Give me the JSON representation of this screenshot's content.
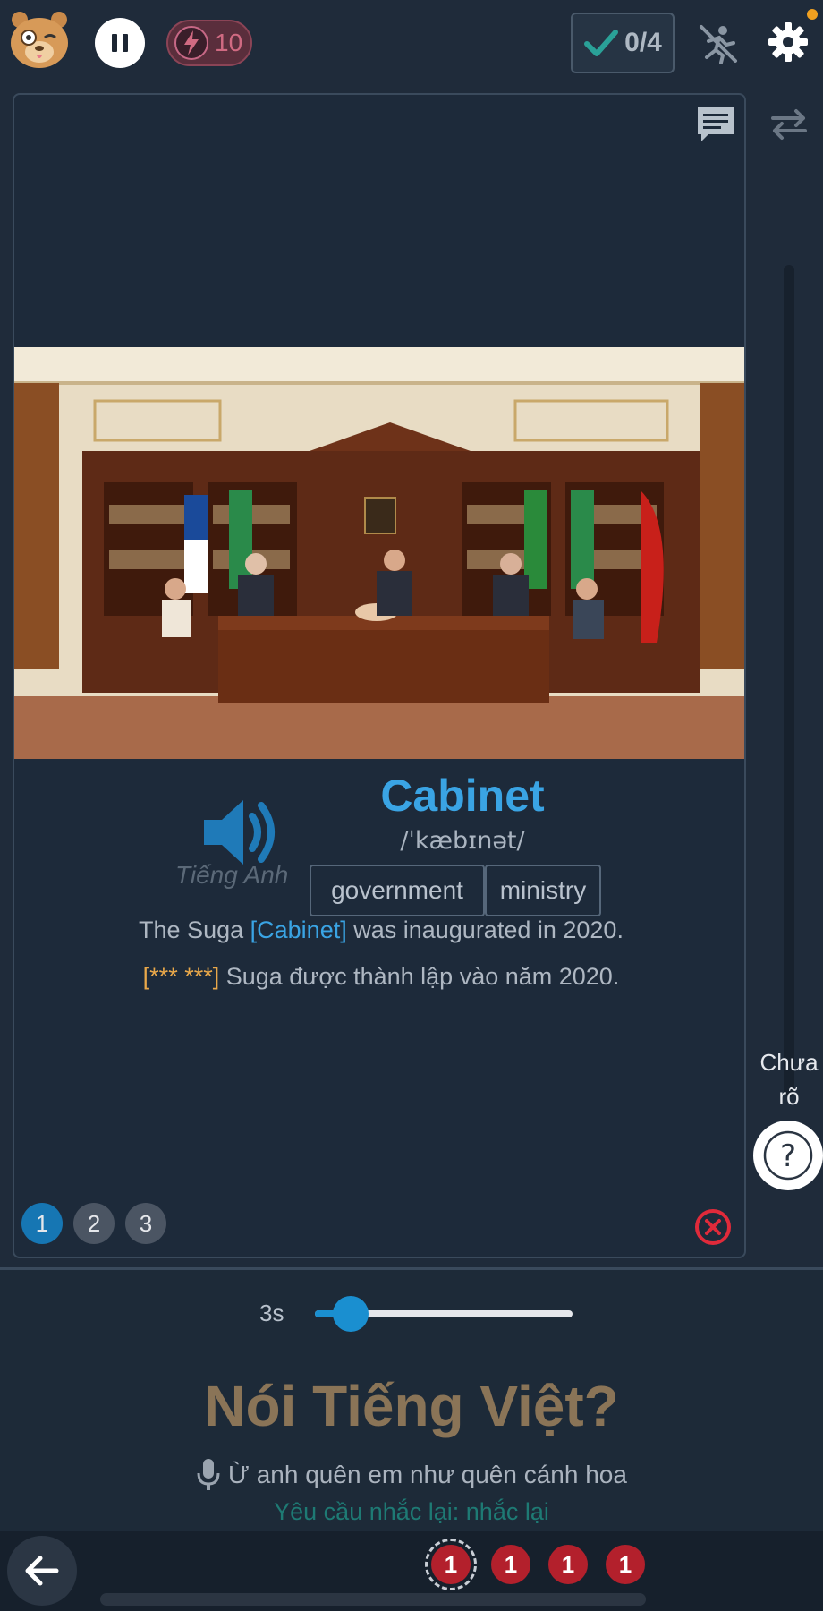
{
  "topbar": {
    "energy_count": "10",
    "score": "0/4"
  },
  "card": {
    "word": "Cabinet",
    "ipa": "/ˈkæbɪnət/",
    "language_label": "Tiếng Anh",
    "synonyms": [
      "government",
      "ministry"
    ],
    "example_en": {
      "before": "The Suga ",
      "highlight": "[Cabinet]",
      "after": " was inaugurated in 2020."
    },
    "example_vi": {
      "highlight": "[*** ***]",
      "after": " Suga được thành lập vào năm 2020."
    },
    "pages": [
      "1",
      "2",
      "3"
    ],
    "active_page": "1"
  },
  "side": {
    "unclear_label": "Chưa rõ",
    "help_symbol": "?"
  },
  "speech": {
    "delay_label": "3s",
    "delay_fraction": 0.14,
    "prompt": "Nói Tiếng Việt?",
    "heard_text": "Ừ anh quên em như quên cánh hoa",
    "repeat_request": "Yêu cầu nhắc lại: nhắc lại"
  },
  "rounds": [
    "1",
    "1",
    "1",
    "1"
  ],
  "colors": {
    "accent_blue": "#3aa4e4",
    "highlight_orange": "#e9a84a",
    "round_red": "#b3202c",
    "prompt_brown": "#8a7457",
    "success_teal": "#2aa198"
  },
  "icons": [
    "mascot-icon",
    "pause-icon",
    "lightning-icon",
    "check-icon",
    "no-running-icon",
    "gear-icon",
    "comment-icon",
    "swap-icon",
    "speaker-icon",
    "close-circle-icon",
    "help-icon",
    "microphone-icon",
    "back-arrow-icon"
  ]
}
